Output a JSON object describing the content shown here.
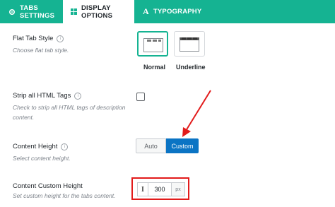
{
  "tabs": [
    {
      "label": "TABS SETTINGS",
      "icon": "gear-icon"
    },
    {
      "label": "DISPLAY OPTIONS",
      "icon": "grid-icon"
    },
    {
      "label": "TYPOGRAPHY",
      "icon": "typography-icon"
    }
  ],
  "settings": {
    "flat_tab_style": {
      "title": "Flat Tab Style",
      "description": "Choose flat tab style.",
      "options": [
        "Normal",
        "Underline"
      ],
      "selected": "Normal"
    },
    "strip_html": {
      "title": "Strip all HTML Tags",
      "description": "Check to strip all HTML tags of description content.",
      "checked": false
    },
    "content_height": {
      "title": "Content Height",
      "description": "Select content height.",
      "options": [
        "Auto",
        "Custom"
      ],
      "selected": "Custom"
    },
    "custom_height": {
      "title": "Content Custom Height",
      "description": "Set custom height for the tabs content.",
      "value": "300",
      "unit": "px",
      "prefix_icon": "text-cursor-icon"
    }
  },
  "colors": {
    "accent": "#15b392",
    "primary_button": "#0b74c4",
    "highlight": "#e21b1b"
  },
  "icons": {
    "info": "i"
  }
}
